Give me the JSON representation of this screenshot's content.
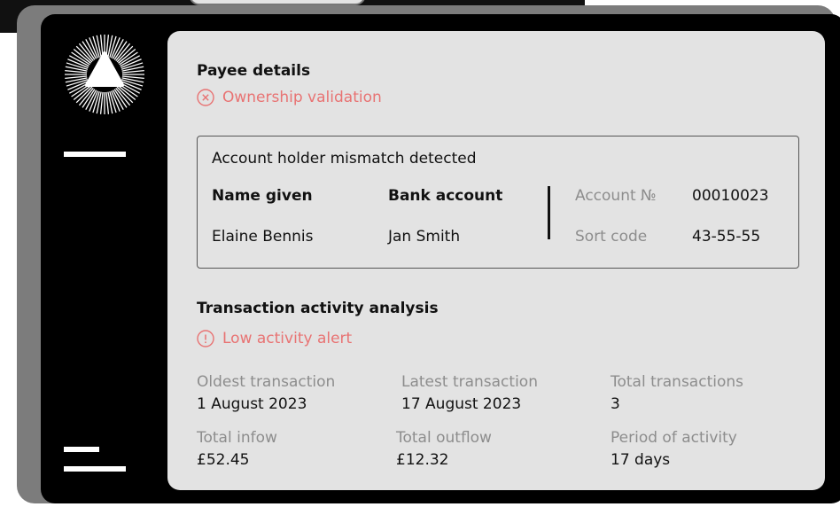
{
  "payee": {
    "title": "Payee details",
    "status": "Ownership validation",
    "status_color": "#e87373"
  },
  "mismatch": {
    "heading": "Account holder mismatch detected",
    "name_given_label": "Name given",
    "bank_account_label": "Bank account",
    "name_given_value": "Elaine Bennis",
    "bank_account_value": "Jan Smith",
    "account_no_label": "Account №",
    "account_no_value": "00010023",
    "sort_code_label": "Sort code",
    "sort_code_value": "43-55-55"
  },
  "activity": {
    "title": "Transaction activity analysis",
    "status": "Low activity alert",
    "stats": [
      {
        "label": "Oldest transaction",
        "value": "1 August 2023"
      },
      {
        "label": "Latest transaction",
        "value": "17 August 2023"
      },
      {
        "label": "Total transactions",
        "value": "3"
      },
      {
        "label": "Total infow",
        "value": "£52.45"
      },
      {
        "label": "Total outflow",
        "value": "£12.32"
      },
      {
        "label": "Period of activity",
        "value": "17 days"
      }
    ]
  },
  "icons": {
    "logo": "radial-triangle-logo",
    "ownership_status": "x-circle-icon",
    "activity_status": "exclamation-circle-icon"
  }
}
